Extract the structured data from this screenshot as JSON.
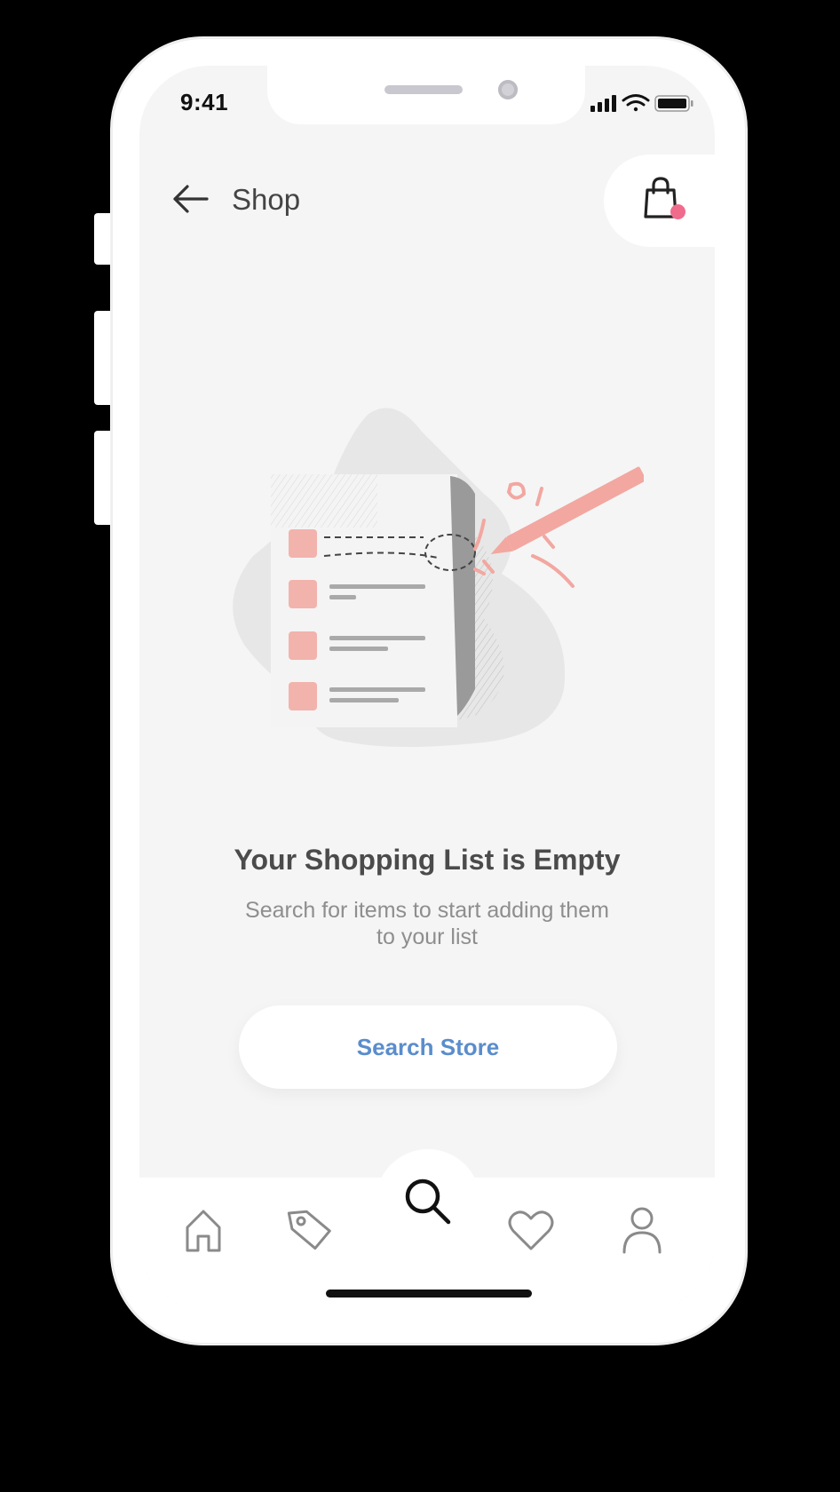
{
  "status_bar": {
    "time": "9:41"
  },
  "header": {
    "title": "Shop",
    "back_icon": "arrow-left-icon",
    "cart_icon": "shopping-bag-icon",
    "cart_badge_color": "#f06c8c"
  },
  "empty_state": {
    "heading": "Your Shopping List is Empty",
    "subtext": "Search for items to start adding them to your list",
    "button_label": "Search Store",
    "illustration": "shopping-list-illustration"
  },
  "tab_bar": {
    "items": [
      {
        "name": "home",
        "icon": "home-icon"
      },
      {
        "name": "deals",
        "icon": "tag-icon"
      },
      {
        "name": "search",
        "icon": "search-icon",
        "active": true
      },
      {
        "name": "favorites",
        "icon": "heart-icon"
      },
      {
        "name": "profile",
        "icon": "user-icon"
      }
    ]
  },
  "colors": {
    "accent": "#5a8dcc",
    "illustration_pink": "#f2a7a0",
    "background": "#f5f5f5"
  }
}
